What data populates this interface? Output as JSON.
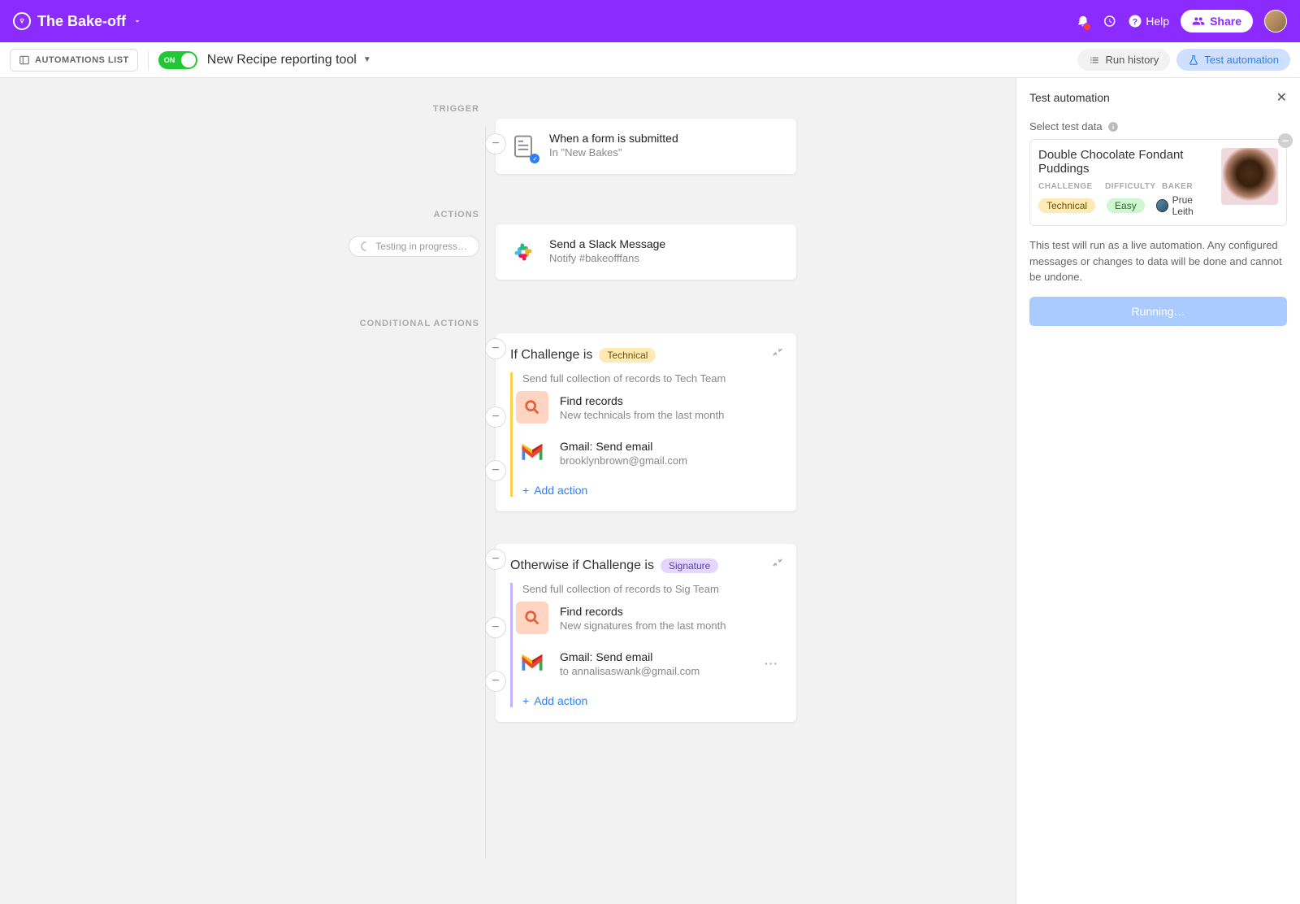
{
  "header": {
    "base_title": "The Bake-off",
    "help_label": "Help",
    "share_label": "Share"
  },
  "toolbar": {
    "automations_list": "AUTOMATIONS LIST",
    "toggle_label": "ON",
    "automation_name": "New Recipe reporting tool",
    "run_history": "Run history",
    "test_automation": "Test automation"
  },
  "flow": {
    "trigger_label": "TRIGGER",
    "actions_label": "ACTIONS",
    "conditional_label": "CONDITIONAL ACTIONS",
    "testing_badge": "Testing in progress…",
    "trigger": {
      "title": "When a form is submitted",
      "sub": "In \"New Bakes\""
    },
    "action1": {
      "title": "Send a Slack Message",
      "sub": "Notify #bakeofffans"
    },
    "cond1": {
      "prefix": "If Challenge is",
      "badge": "Technical",
      "desc": "Send full collection of records to Tech Team",
      "a1_title": "Find records",
      "a1_sub": "New technicals from the last month",
      "a2_title": "Gmail: Send email",
      "a2_sub": "brooklynbrown@gmail.com",
      "add": "Add action"
    },
    "cond2": {
      "prefix": "Otherwise if Challenge is",
      "badge": "Signature",
      "desc": "Send full collection of records to Sig Team",
      "a1_title": "Find records",
      "a1_sub": "New signatures from the last month",
      "a2_title": "Gmail: Send email",
      "a2_sub": "to annalisaswank@gmail.com",
      "add": "Add action"
    }
  },
  "panel": {
    "title": "Test automation",
    "select_label": "Select test data",
    "record_title": "Double Chocolate Fondant Puddings",
    "field_challenge": "CHALLENGE",
    "field_difficulty": "DIFFICULTY",
    "field_baker": "BAKER",
    "val_challenge": "Technical",
    "val_difficulty": "Easy",
    "val_baker": "Prue Leith",
    "warning": "This test will run as a live automation. Any configured messages or changes to data will be done and cannot be undone.",
    "running": "Running…"
  }
}
